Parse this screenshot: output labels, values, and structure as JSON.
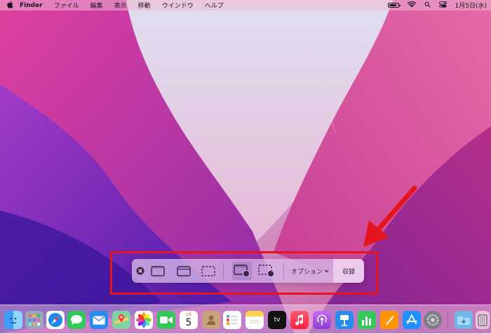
{
  "menubar": {
    "app_name": "Finder",
    "menus": [
      "ファイル",
      "編集",
      "表示",
      "移動",
      "ウインドウ",
      "ヘルプ"
    ],
    "clock": "1月5日(水)"
  },
  "toolbar": {
    "options_label": "オプション",
    "record_label": "収録"
  },
  "dock": {
    "calendar_month": "1月",
    "calendar_day": "5",
    "tv_label": "tv"
  },
  "colors": {
    "annotation": "#e4151e"
  }
}
